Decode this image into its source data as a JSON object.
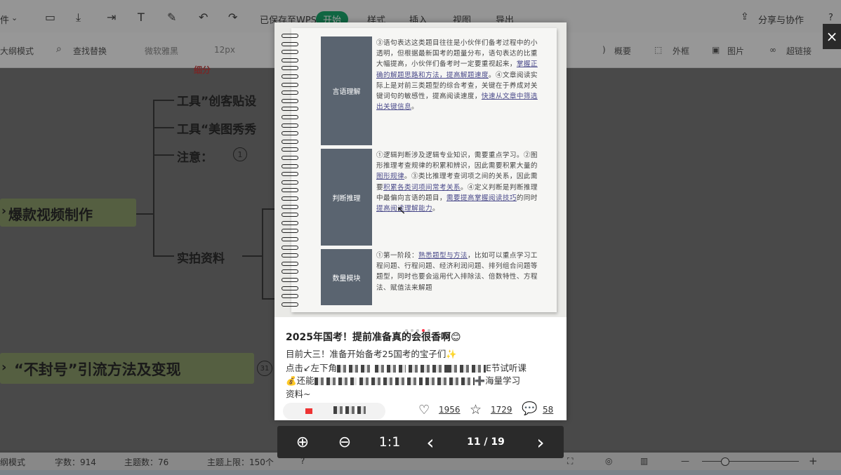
{
  "menubar": {
    "file": "件",
    "saved": "已保存至WPS",
    "start": "开始",
    "style": "样式",
    "insert": "插入",
    "view": "视图",
    "export": "导出",
    "share": "分享与协作",
    "help": "?"
  },
  "toolbar": {
    "outline_mode": "大纲模式",
    "find_replace": "查找替换",
    "font": "微软雅黑",
    "size": "12px",
    "summary": "概要",
    "frame": "外框",
    "image": "图片",
    "hyperlink": "超链接"
  },
  "mindmap": {
    "tool1": "工具”创客贴设",
    "tool2": "工具“美图秀秀",
    "note": "注意：",
    "note_badge": "1",
    "viral": "爆款视频制作",
    "footage": "实拍资料",
    "no_ban": "“不封号”引流方法及变现",
    "no_ban_badge": "31",
    "top_fragment": "细分"
  },
  "notebook": {
    "rows": [
      {
        "label": "言语理解",
        "parts": [
          {
            "t": "③语句表达这类题目往往是小伙伴们备考过程中的小透明，但根据最新国考的题量分布，语句表达的比重大幅提高，小伙伴们备考时一定要重视起来，"
          },
          {
            "t": "掌握正确的解题思路和方法，提高解题速度",
            "u": true
          },
          {
            "t": "。④文章阅读实际上是对前三类题型的综合考查，关键在于养成对关键词句的敏感性，提高阅读速度，"
          },
          {
            "t": "快速从文章中筛选出关键信息",
            "u": true
          },
          {
            "t": "。"
          }
        ]
      },
      {
        "label": "判断推理",
        "parts": [
          {
            "t": "①逻辑判断涉及逻辑专业知识，需要重点学习。②图形推理考查规律的积累和辨识，因此需要积累大量的"
          },
          {
            "t": "图形规律",
            "u": true
          },
          {
            "t": "。③类比推理考查词项之间的关系，因此需要"
          },
          {
            "t": "积累各类词项间常考关系",
            "u": true
          },
          {
            "t": "。④定义判断是判断推理中最偏向言语的题目，"
          },
          {
            "t": "需要提高掌握阅读技巧",
            "u": true
          },
          {
            "t": "的同时"
          },
          {
            "t": "提高阅读理解能力",
            "u": true
          },
          {
            "t": "。"
          }
        ]
      },
      {
        "label": "数量模块",
        "parts": [
          {
            "t": "①第一阶段："
          },
          {
            "t": "熟悉题型与方法",
            "u": true
          },
          {
            "t": "，比如可以重点学习工程问题、行程问题、经济利润问题、排列组合问题等题型，同时也要会运用代入排除法、倍数特性、方程法、赋值法来解题"
          }
        ]
      }
    ]
  },
  "post": {
    "title": "2025年国考！提前准备真的会很香啊😊",
    "line1": "目前大三！准备开始备考25国考的宝子们✨",
    "line2_start": "点击↙左下角",
    "line2_end": "E节试听课",
    "line3_start": "💰还能",
    "line3_end": "➕海量学习",
    "line4": "资料~",
    "likes": "1956",
    "favorites": "1729",
    "comments": "58"
  },
  "controls": {
    "zoom_in": "⊕",
    "zoom_out": "⊖",
    "actual_size": "1:1",
    "prev": "‹",
    "page": "11 / 19",
    "next": "›",
    "close": "×"
  },
  "statusbar": {
    "outline": "纲模式",
    "word_count": "字数：914",
    "topic_count": "主题数：76",
    "topic_limit": "主题上限：150个",
    "zoom_minus": "—",
    "zoom_plus": "+"
  },
  "colors": {
    "accent_green": "#1aa56b",
    "viewer_bg": "#ffffff",
    "label_cell": "#5a6470",
    "control_bar": "#2a2a2a",
    "indicator_active": "#ff3b4e"
  }
}
